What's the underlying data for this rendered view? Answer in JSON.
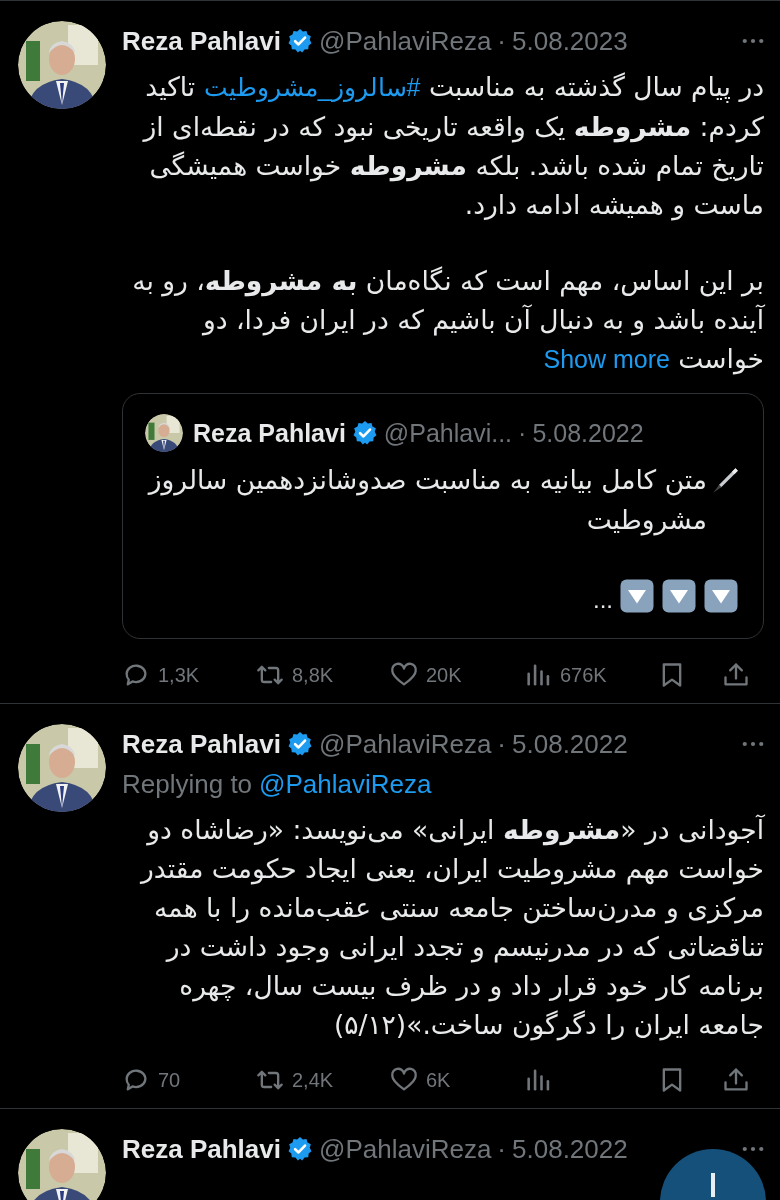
{
  "tweets": [
    {
      "author": {
        "name": "Reza Pahlavi",
        "handle": "@PahlaviReza",
        "separator": "·",
        "date": "5.08.2023"
      },
      "paragraphs": [
        [
          {
            "kind": "text",
            "text": "در پیام سال گذشته به مناسبت "
          },
          {
            "kind": "hashtag",
            "text": "#سالروز_مشروطیت"
          },
          {
            "kind": "text",
            "text": " تاکید کردم: **مشروطه** یک واقعه تاریخی نبود که در نقطه‌ای از تاریخ تمام شده باشد. بلکه **مشروطه** خواست همیشگی ماست و همیشه ادامه دارد."
          }
        ],
        [
          {
            "kind": "text",
            "text": "بر این اساس، مهم است که نگاه‌مان **به مشروطه**، رو به آینده باشد و به دنبال آن باشیم که در ایران فردا، دو خواست "
          },
          {
            "kind": "more",
            "text": "Show more"
          }
        ]
      ],
      "quote": {
        "author": {
          "name": "Reza Pahlavi",
          "handle": "@Pahlavi...",
          "separator": "·",
          "date": "5.08.2022"
        },
        "text": "متن کامل بیانیه به مناسبت صدوشانزدهمین سالروز مشروطیت",
        "trailing": "..."
      },
      "actions": [
        {
          "kind": "share"
        },
        {
          "kind": "bookmark"
        },
        {
          "kind": "views",
          "count": "676K"
        },
        {
          "kind": "like",
          "count": "20K"
        },
        {
          "kind": "repost",
          "count": "8,8K"
        },
        {
          "kind": "reply",
          "count": "1,3K"
        }
      ]
    },
    {
      "author": {
        "name": "Reza Pahlavi",
        "handle": "@PahlaviReza",
        "separator": "·",
        "date": "5.08.2022"
      },
      "replying_to": {
        "label": "Replying to",
        "handle": "@PahlaviReza"
      },
      "paragraphs": [
        [
          {
            "kind": "text",
            "text": "آجودانی در «**مشروطه** ایرانی» می‌نویسد: «رضاشاه دو خواست مهم مشروطیت ایران، یعنی ایجاد حکومت مقتدر مرکزی و مدرن‌ساختن جامعه سنتی عقب‌مانده را با همه تناقضاتی که در مدرنیسم و تجدد ایرانی وجود داشت در برنامه کار خود قرار داد و در ظرف بیست سال، چهره جامعه ایران را دگرگون ساخت.»(۵/۱۲)"
          }
        ]
      ],
      "actions": [
        {
          "kind": "share"
        },
        {
          "kind": "bookmark"
        },
        {
          "kind": "views"
        },
        {
          "kind": "like",
          "count": "6K"
        },
        {
          "kind": "repost",
          "count": "2,4K"
        },
        {
          "kind": "reply",
          "count": "70"
        }
      ]
    },
    {
      "author": {
        "name": "Reza Pahlavi",
        "handle": "@PahlaviReza",
        "separator": "·",
        "date": "5.08.2022"
      }
    }
  ]
}
